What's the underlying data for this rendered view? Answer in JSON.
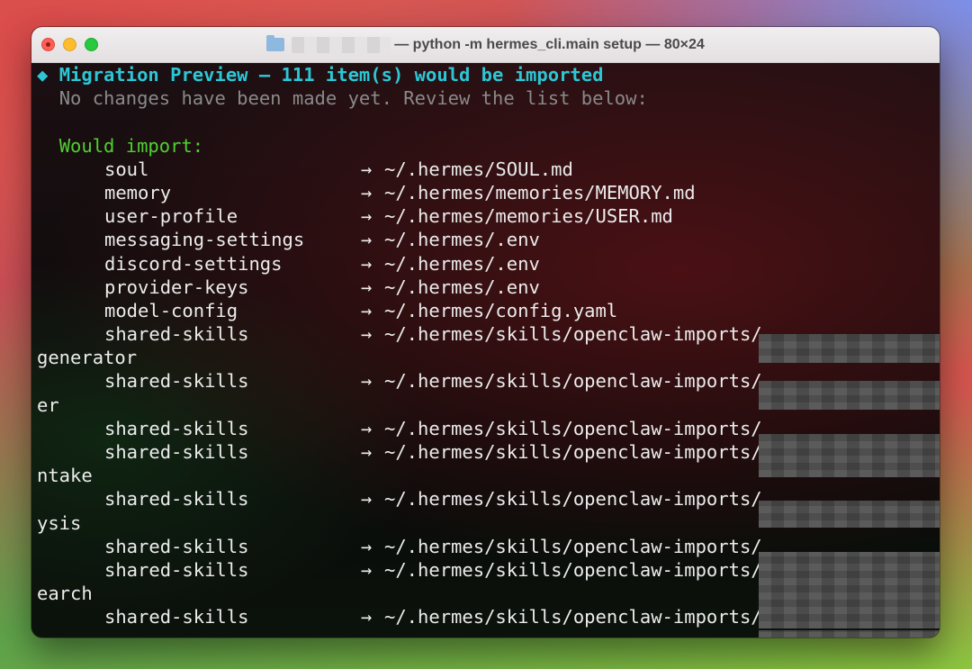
{
  "window": {
    "title": "— python -m hermes_cli.main setup — 80×24"
  },
  "terminal": {
    "header_bullet": "◆",
    "header": "Migration Preview — 111 item(s) would be imported",
    "subheader": "No changes have been made yet. Review the list below:",
    "section_label": "Would import:",
    "arrow": "→",
    "rows": [
      {
        "name": "soul",
        "dest": "~/.hermes/SOUL.md"
      },
      {
        "name": "memory",
        "dest": "~/.hermes/memories/MEMORY.md"
      },
      {
        "name": "user-profile",
        "dest": "~/.hermes/memories/USER.md"
      },
      {
        "name": "messaging-settings",
        "dest": "~/.hermes/.env"
      },
      {
        "name": "discord-settings",
        "dest": "~/.hermes/.env"
      },
      {
        "name": "provider-keys",
        "dest": "~/.hermes/.env"
      },
      {
        "name": "model-config",
        "dest": "~/.hermes/config.yaml"
      },
      {
        "name": "shared-skills",
        "dest": "~/.hermes/skills/openclaw-imports/"
      },
      {
        "wrap": "generator"
      },
      {
        "name": "shared-skills",
        "dest": "~/.hermes/skills/openclaw-imports/"
      },
      {
        "wrap": "er"
      },
      {
        "name": "shared-skills",
        "dest": "~/.hermes/skills/openclaw-imports/"
      },
      {
        "name": "shared-skills",
        "dest": "~/.hermes/skills/openclaw-imports/"
      },
      {
        "wrap": "ntake"
      },
      {
        "name": "shared-skills",
        "dest": "~/.hermes/skills/openclaw-imports/"
      },
      {
        "wrap": "ysis"
      },
      {
        "name": "shared-skills",
        "dest": "~/.hermes/skills/openclaw-imports/"
      },
      {
        "name": "shared-skills",
        "dest": "~/.hermes/skills/openclaw-imports/"
      },
      {
        "wrap": "earch"
      },
      {
        "name": "shared-skills",
        "dest": "~/.hermes/skills/openclaw-imports/"
      }
    ]
  },
  "colors": {
    "header": "#2cc7d6",
    "section_label": "#4fd12f",
    "dim_text": "#8a8a8a",
    "close": "#ff5f57",
    "minimize": "#febc2e",
    "zoom": "#28c840"
  }
}
